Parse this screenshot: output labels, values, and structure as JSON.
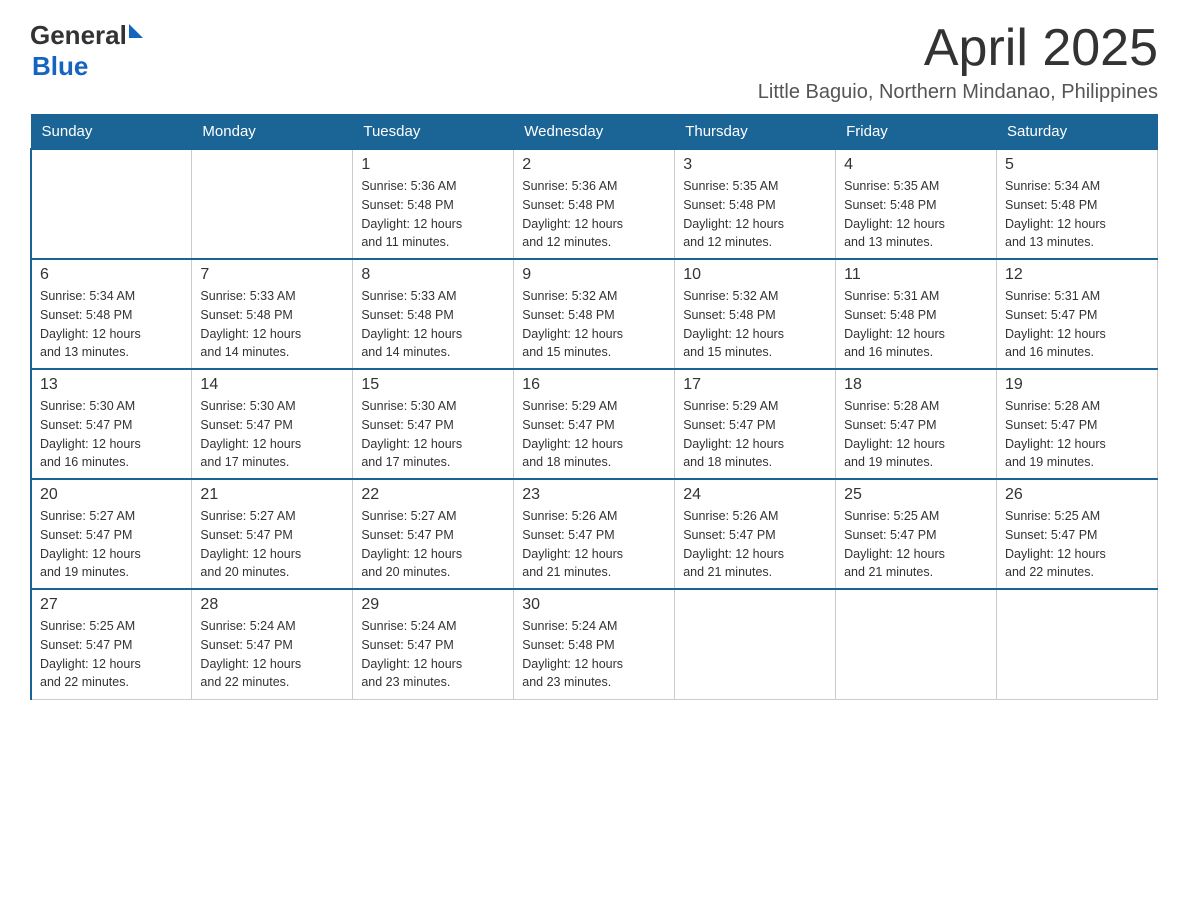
{
  "logo": {
    "general": "General",
    "blue": "Blue",
    "triangle": "▶"
  },
  "title": "April 2025",
  "subtitle": "Little Baguio, Northern Mindanao, Philippines",
  "days_of_week": [
    "Sunday",
    "Monday",
    "Tuesday",
    "Wednesday",
    "Thursday",
    "Friday",
    "Saturday"
  ],
  "weeks": [
    [
      {
        "day": "",
        "info": ""
      },
      {
        "day": "",
        "info": ""
      },
      {
        "day": "1",
        "info": "Sunrise: 5:36 AM\nSunset: 5:48 PM\nDaylight: 12 hours\nand 11 minutes."
      },
      {
        "day": "2",
        "info": "Sunrise: 5:36 AM\nSunset: 5:48 PM\nDaylight: 12 hours\nand 12 minutes."
      },
      {
        "day": "3",
        "info": "Sunrise: 5:35 AM\nSunset: 5:48 PM\nDaylight: 12 hours\nand 12 minutes."
      },
      {
        "day": "4",
        "info": "Sunrise: 5:35 AM\nSunset: 5:48 PM\nDaylight: 12 hours\nand 13 minutes."
      },
      {
        "day": "5",
        "info": "Sunrise: 5:34 AM\nSunset: 5:48 PM\nDaylight: 12 hours\nand 13 minutes."
      }
    ],
    [
      {
        "day": "6",
        "info": "Sunrise: 5:34 AM\nSunset: 5:48 PM\nDaylight: 12 hours\nand 13 minutes."
      },
      {
        "day": "7",
        "info": "Sunrise: 5:33 AM\nSunset: 5:48 PM\nDaylight: 12 hours\nand 14 minutes."
      },
      {
        "day": "8",
        "info": "Sunrise: 5:33 AM\nSunset: 5:48 PM\nDaylight: 12 hours\nand 14 minutes."
      },
      {
        "day": "9",
        "info": "Sunrise: 5:32 AM\nSunset: 5:48 PM\nDaylight: 12 hours\nand 15 minutes."
      },
      {
        "day": "10",
        "info": "Sunrise: 5:32 AM\nSunset: 5:48 PM\nDaylight: 12 hours\nand 15 minutes."
      },
      {
        "day": "11",
        "info": "Sunrise: 5:31 AM\nSunset: 5:48 PM\nDaylight: 12 hours\nand 16 minutes."
      },
      {
        "day": "12",
        "info": "Sunrise: 5:31 AM\nSunset: 5:47 PM\nDaylight: 12 hours\nand 16 minutes."
      }
    ],
    [
      {
        "day": "13",
        "info": "Sunrise: 5:30 AM\nSunset: 5:47 PM\nDaylight: 12 hours\nand 16 minutes."
      },
      {
        "day": "14",
        "info": "Sunrise: 5:30 AM\nSunset: 5:47 PM\nDaylight: 12 hours\nand 17 minutes."
      },
      {
        "day": "15",
        "info": "Sunrise: 5:30 AM\nSunset: 5:47 PM\nDaylight: 12 hours\nand 17 minutes."
      },
      {
        "day": "16",
        "info": "Sunrise: 5:29 AM\nSunset: 5:47 PM\nDaylight: 12 hours\nand 18 minutes."
      },
      {
        "day": "17",
        "info": "Sunrise: 5:29 AM\nSunset: 5:47 PM\nDaylight: 12 hours\nand 18 minutes."
      },
      {
        "day": "18",
        "info": "Sunrise: 5:28 AM\nSunset: 5:47 PM\nDaylight: 12 hours\nand 19 minutes."
      },
      {
        "day": "19",
        "info": "Sunrise: 5:28 AM\nSunset: 5:47 PM\nDaylight: 12 hours\nand 19 minutes."
      }
    ],
    [
      {
        "day": "20",
        "info": "Sunrise: 5:27 AM\nSunset: 5:47 PM\nDaylight: 12 hours\nand 19 minutes."
      },
      {
        "day": "21",
        "info": "Sunrise: 5:27 AM\nSunset: 5:47 PM\nDaylight: 12 hours\nand 20 minutes."
      },
      {
        "day": "22",
        "info": "Sunrise: 5:27 AM\nSunset: 5:47 PM\nDaylight: 12 hours\nand 20 minutes."
      },
      {
        "day": "23",
        "info": "Sunrise: 5:26 AM\nSunset: 5:47 PM\nDaylight: 12 hours\nand 21 minutes."
      },
      {
        "day": "24",
        "info": "Sunrise: 5:26 AM\nSunset: 5:47 PM\nDaylight: 12 hours\nand 21 minutes."
      },
      {
        "day": "25",
        "info": "Sunrise: 5:25 AM\nSunset: 5:47 PM\nDaylight: 12 hours\nand 21 minutes."
      },
      {
        "day": "26",
        "info": "Sunrise: 5:25 AM\nSunset: 5:47 PM\nDaylight: 12 hours\nand 22 minutes."
      }
    ],
    [
      {
        "day": "27",
        "info": "Sunrise: 5:25 AM\nSunset: 5:47 PM\nDaylight: 12 hours\nand 22 minutes."
      },
      {
        "day": "28",
        "info": "Sunrise: 5:24 AM\nSunset: 5:47 PM\nDaylight: 12 hours\nand 22 minutes."
      },
      {
        "day": "29",
        "info": "Sunrise: 5:24 AM\nSunset: 5:47 PM\nDaylight: 12 hours\nand 23 minutes."
      },
      {
        "day": "30",
        "info": "Sunrise: 5:24 AM\nSunset: 5:48 PM\nDaylight: 12 hours\nand 23 minutes."
      },
      {
        "day": "",
        "info": ""
      },
      {
        "day": "",
        "info": ""
      },
      {
        "day": "",
        "info": ""
      }
    ]
  ]
}
